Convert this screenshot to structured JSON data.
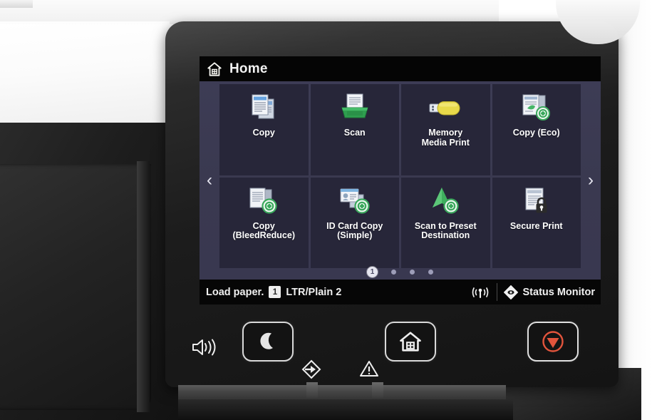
{
  "device": {
    "type": "multifunction-printer-control-panel"
  },
  "screen": {
    "titlebar": {
      "home_icon": "home-icon",
      "title": "Home"
    },
    "navigation": {
      "prev_arrow": "‹",
      "next_arrow": "›"
    },
    "tiles": [
      {
        "id": "copy",
        "label": "Copy",
        "icon": "copy-documents-icon"
      },
      {
        "id": "scan",
        "label": "Scan",
        "icon": "scan-tray-icon"
      },
      {
        "id": "memory-media-print",
        "label": "Memory\nMedia Print",
        "icon": "usb-drive-icon"
      },
      {
        "id": "copy-eco",
        "label": "Copy (Eco)",
        "icon": "copy-eco-icon"
      },
      {
        "id": "copy-bleedreduce",
        "label": "Copy\n(BleedReduce)",
        "icon": "copy-eco-doc-icon"
      },
      {
        "id": "id-card-copy",
        "label": "ID Card Copy\n(Simple)",
        "icon": "id-card-eco-icon"
      },
      {
        "id": "scan-to-preset",
        "label": "Scan to Preset\nDestination",
        "icon": "scan-arrow-eco-icon"
      },
      {
        "id": "secure-print",
        "label": "Secure Print",
        "icon": "document-lock-icon"
      }
    ],
    "pager": {
      "pages": [
        "1",
        "",
        "",
        ""
      ],
      "active_index": 0,
      "active_label": "1"
    },
    "statusbar": {
      "message": "Load paper.",
      "tray_number": "1",
      "paper_info": "LTR/Plain 2",
      "wifi_icon": "wifi-signal-icon",
      "status_monitor_icon": "status-monitor-diamond-icon",
      "status_monitor_label": "Status Monitor"
    }
  },
  "hardware": {
    "buttons": [
      {
        "id": "sleep",
        "icon": "crescent-moon-icon",
        "name": "energy-saver-button"
      },
      {
        "id": "home",
        "icon": "home-house-icon",
        "name": "home-button"
      },
      {
        "id": "stop",
        "icon": "stop-circle-icon",
        "name": "stop-button"
      }
    ],
    "indicators": [
      {
        "id": "speaker",
        "icon": "speaker-volume-icon"
      },
      {
        "id": "data",
        "icon": "data-arrow-icon"
      },
      {
        "id": "error",
        "icon": "warning-triangle-icon"
      }
    ]
  },
  "colors": {
    "panel_bezel": "#1c1c1c",
    "screen_bg": "#000000",
    "tile_area_bg": "#3a3950",
    "tile_bg": "#272639",
    "accent_eco_green": "#3aa85c",
    "accent_usb_yellow": "#e8d94a",
    "accent_scan_green": "#2a9d4e",
    "stop_red": "#e2543c",
    "text_primary": "#ffffff",
    "printer_body": "#f4f4f4"
  }
}
